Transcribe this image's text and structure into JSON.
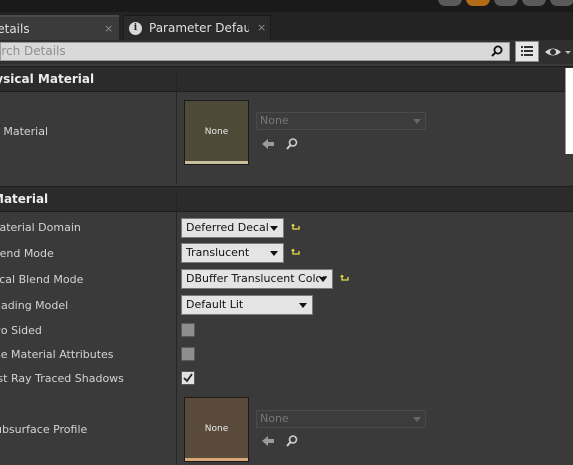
{
  "tabs": [
    {
      "label": "Details",
      "active": true
    },
    {
      "label": "Parameter Defaults",
      "active": false
    }
  ],
  "tab_close_glyph": "×",
  "search": {
    "placeholder": "Search Details",
    "value": ""
  },
  "sections": {
    "physical_material": {
      "title": "Physical Material",
      "rows": {
        "phys_material": {
          "label": "Phys Material",
          "thumbnail_label": "None",
          "combo_value": "None"
        }
      }
    },
    "material": {
      "title": "Material",
      "rows": {
        "material_domain": {
          "label": "Material Domain",
          "value": "Deferred Decal"
        },
        "blend_mode": {
          "label": "Blend Mode",
          "value": "Translucent"
        },
        "decal_blend_mode": {
          "label": "Decal Blend Mode",
          "value": "DBuffer Translucent Color"
        },
        "shading_model": {
          "label": "Shading Model",
          "value": "Default Lit"
        },
        "two_sided": {
          "label": "Two Sided",
          "checked": false
        },
        "use_material_attributes": {
          "label": "Use Material Attributes",
          "checked": false
        },
        "cast_ray_traced_shadows": {
          "label": "Cast Ray Traced Shadows",
          "checked": true
        },
        "subsurface_profile": {
          "label": "Subsurface Profile",
          "thumbnail_label": "None",
          "combo_value": "None"
        }
      }
    }
  },
  "icons": [
    "info-icon",
    "close-icon",
    "search-icon",
    "list-view-icon",
    "eye-icon",
    "chevron-down-icon",
    "reset-to-default-icon",
    "use-selected-arrow-icon",
    "browse-magnifier-icon",
    "checkmark-icon"
  ],
  "colors": {
    "phys_thumb_bg": "#4d4a38",
    "phys_thumb_bar": "#c8c09a",
    "subsurface_thumb_bg": "#5a4a3c",
    "subsurface_thumb_bar": "#d8a878",
    "reset_arrow": "#e8e04a",
    "panel_bg": "#3a3a3a",
    "section_header_bg": "#2b2b2b"
  }
}
